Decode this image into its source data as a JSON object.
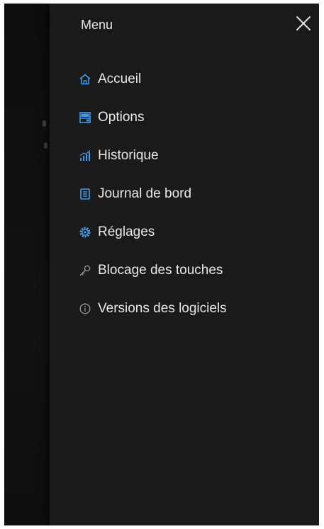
{
  "menu": {
    "title": "Menu",
    "items": [
      {
        "label": "Accueil",
        "icon": "home-icon"
      },
      {
        "label": "Options",
        "icon": "options-icon"
      },
      {
        "label": "Historique",
        "icon": "history-chart-icon"
      },
      {
        "label": "Journal de bord",
        "icon": "logbook-icon"
      },
      {
        "label": "Réglages",
        "icon": "gear-icon"
      },
      {
        "label": "Blocage des touches",
        "icon": "key-icon"
      },
      {
        "label": "Versions des logiciels",
        "icon": "info-icon"
      }
    ]
  },
  "colors": {
    "accent": "#3f9bea",
    "icon_muted": "#9a9a9a",
    "drawer_bg": "#1a1a1a"
  }
}
